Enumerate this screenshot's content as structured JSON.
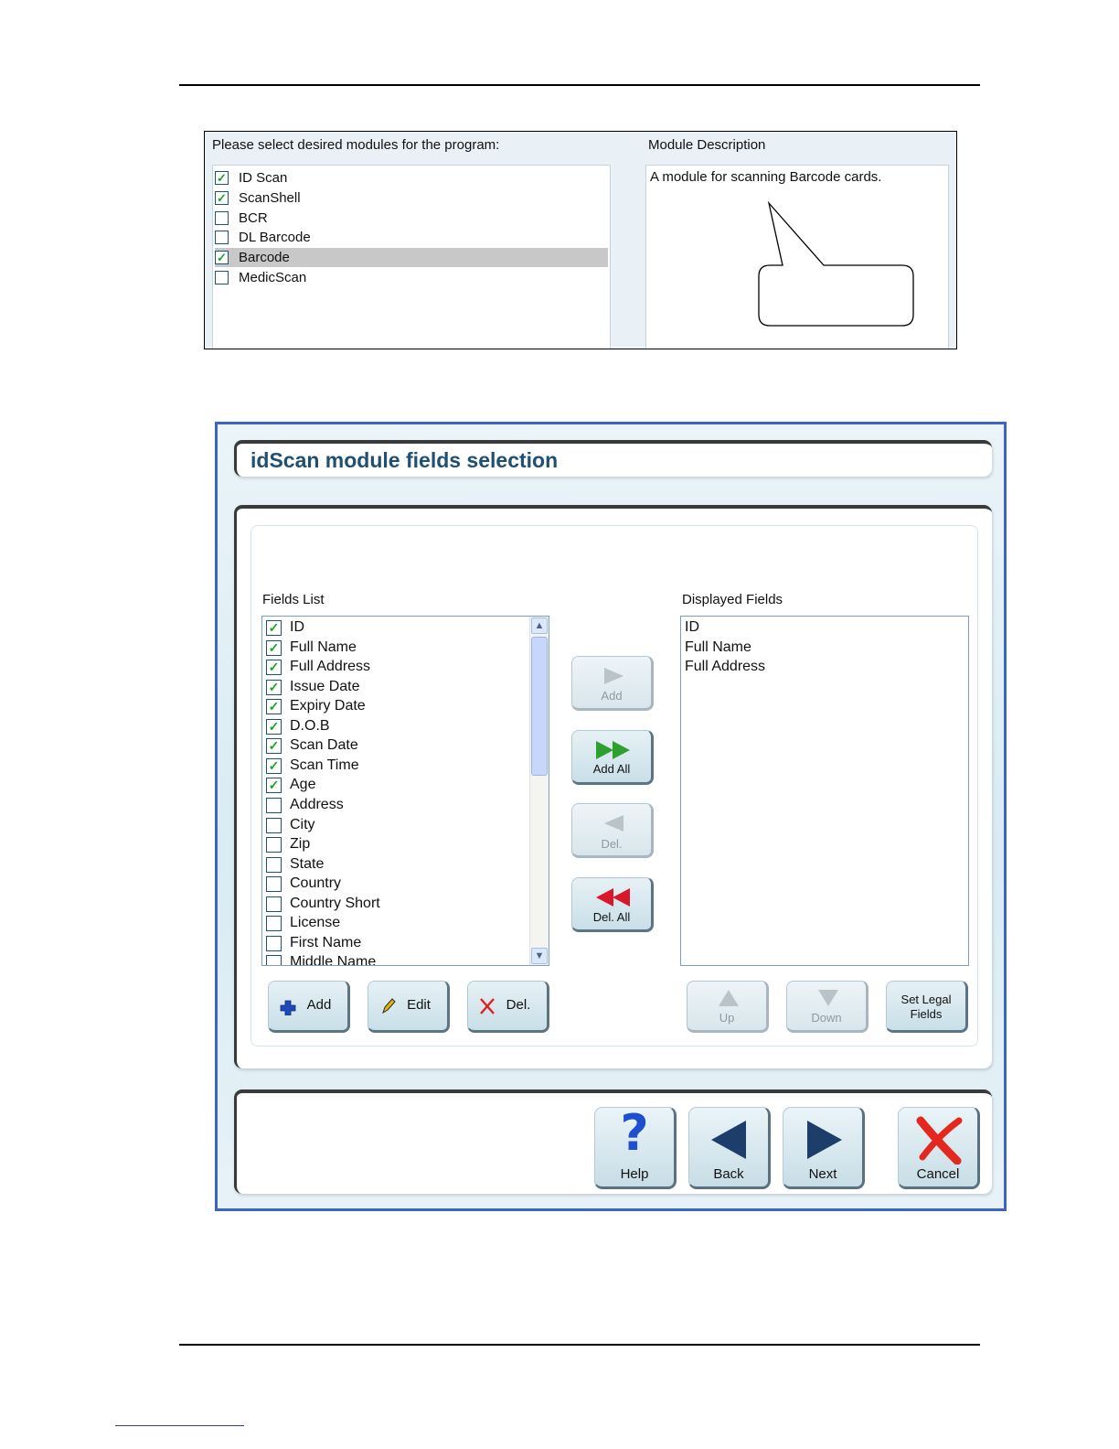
{
  "modules_panel": {
    "prompt": "Please select desired modules for the program:",
    "description_label": "Module Description",
    "description_text": "A module for scanning Barcode cards.",
    "modules": [
      {
        "label": "ID Scan",
        "checked": true,
        "selected": false
      },
      {
        "label": "ScanShell",
        "checked": true,
        "selected": false
      },
      {
        "label": "BCR",
        "checked": false,
        "selected": false
      },
      {
        "label": "DL Barcode",
        "checked": false,
        "selected": false
      },
      {
        "label": "Barcode",
        "checked": true,
        "selected": true
      },
      {
        "label": "MedicScan",
        "checked": false,
        "selected": false
      }
    ]
  },
  "wizard": {
    "title": "idScan module fields selection",
    "fields_list_label": "Fields List",
    "displayed_fields_label": "Displayed Fields",
    "fields": [
      {
        "label": "ID",
        "checked": true
      },
      {
        "label": "Full Name",
        "checked": true
      },
      {
        "label": "Full Address",
        "checked": true
      },
      {
        "label": "Issue Date",
        "checked": true
      },
      {
        "label": "Expiry Date",
        "checked": true
      },
      {
        "label": "D.O.B",
        "checked": true
      },
      {
        "label": "Scan Date",
        "checked": true
      },
      {
        "label": "Scan Time",
        "checked": true
      },
      {
        "label": "Age",
        "checked": true
      },
      {
        "label": "Address",
        "checked": false
      },
      {
        "label": "City",
        "checked": false
      },
      {
        "label": "Zip",
        "checked": false
      },
      {
        "label": "State",
        "checked": false
      },
      {
        "label": "Country",
        "checked": false
      },
      {
        "label": "Country Short",
        "checked": false
      },
      {
        "label": "License",
        "checked": false
      },
      {
        "label": "First Name",
        "checked": false
      },
      {
        "label": "Middle Name",
        "checked": false
      }
    ],
    "displayed_fields": [
      "ID",
      "Full Name",
      "Full Address"
    ],
    "transfer_buttons": {
      "add": "Add",
      "add_all": "Add All",
      "del": "Del.",
      "del_all": "Del. All"
    },
    "list_buttons": {
      "add": "Add",
      "edit": "Edit",
      "del": "Del."
    },
    "order_buttons": {
      "up": "Up",
      "down": "Down",
      "set_legal_line1": "Set Legal",
      "set_legal_line2": "Fields"
    },
    "nav_buttons": {
      "help": "Help",
      "back": "Back",
      "next": "Next",
      "cancel": "Cancel"
    },
    "colors": {
      "window_border": "#3d63c4",
      "title_text": "#1f4f73",
      "check_green": "#1fa31f",
      "add_all_green": "#2ea02e",
      "del_all_red": "#d8182a",
      "nav_arrow": "#1d3d6b",
      "help_blue": "#1e4fcf",
      "cancel_red": "#e5281f"
    }
  }
}
